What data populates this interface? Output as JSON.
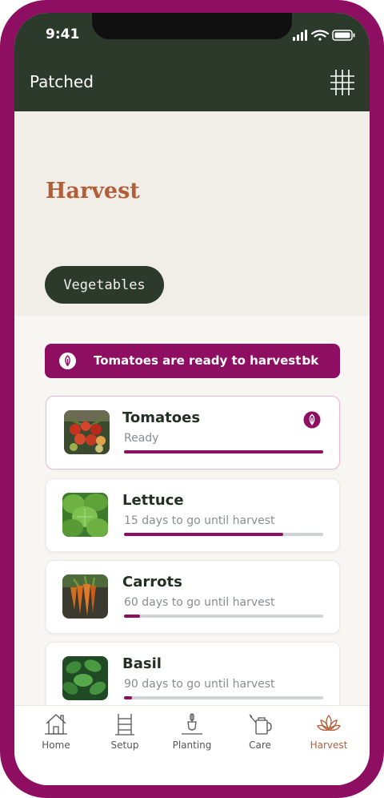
{
  "status_bar": {
    "time": "9:41"
  },
  "app": {
    "title": "Patched",
    "grid_icon": "grid-icon"
  },
  "hero": {
    "title": "Harvest",
    "chip": "Vegetables"
  },
  "banner": {
    "text": "Tomatoes are ready to harvest!",
    "ok": "ok",
    "icon": "leaf-icon"
  },
  "crops": [
    {
      "name": "Tomatoes",
      "status": "Ready",
      "progress": 1.0
    },
    {
      "name": "Lettuce",
      "status": "15 days to go until harvest",
      "progress": 0.8
    },
    {
      "name": "Carrots",
      "status": "60 days to go until harvest",
      "progress": 0.08
    },
    {
      "name": "Basil",
      "status": "90 days to go until harvest",
      "progress": 0.04
    }
  ],
  "nav": [
    {
      "label": "Home",
      "icon": "home-icon"
    },
    {
      "label": "Setup",
      "icon": "ladder-icon"
    },
    {
      "label": "Planting",
      "icon": "trowel-icon"
    },
    {
      "label": "Care",
      "icon": "watering-can-icon"
    },
    {
      "label": "Harvest",
      "icon": "lotus-icon",
      "active": true
    }
  ],
  "colors": {
    "brand": "#8e0e62",
    "header": "#2b3a2b",
    "accent": "#b25e39"
  }
}
